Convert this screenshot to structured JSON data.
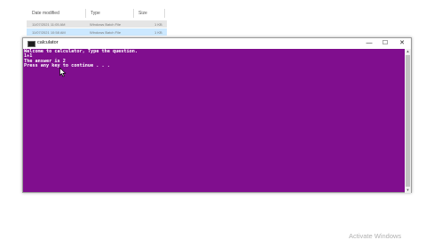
{
  "explorer": {
    "columns": {
      "date_modified": "Date modified",
      "type": "Type",
      "size": "Size"
    },
    "files": [
      {
        "date": "11/07/2021 11:05 AM",
        "type": "Windows Batch File",
        "size": "1 KB"
      },
      {
        "date": "11/07/2021 10:58 AM",
        "type": "Windows Batch File",
        "size": "1 KB"
      }
    ]
  },
  "console": {
    "title": "calculator",
    "background_color": "#800e8e",
    "text_color": "#ffffff",
    "lines": [
      "Welcome to calculator, Type the question.",
      "1+1",
      "The answer is 2",
      "Press any key to continue . . ."
    ],
    "buttons": {
      "minimize": "—",
      "maximize": "☐",
      "close": "✕"
    }
  },
  "watermark": "Activate Windows"
}
